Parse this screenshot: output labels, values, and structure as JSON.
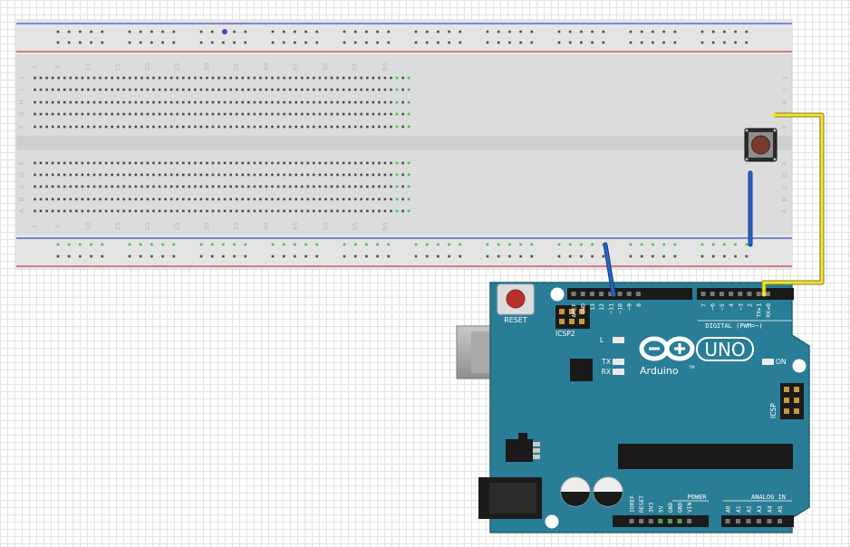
{
  "breadboard": {
    "column_numbers": [
      "1",
      "5",
      "10",
      "15",
      "20",
      "25",
      "30",
      "35",
      "40",
      "45",
      "50",
      "55",
      "60"
    ],
    "row_letters_top": [
      "J",
      "I",
      "H",
      "G",
      "F"
    ],
    "row_letters_bottom": [
      "E",
      "D",
      "C",
      "B",
      "A"
    ]
  },
  "arduino": {
    "reset_label": "RESET",
    "icsp2_label": "ICSP2",
    "icsp_label": "ICSP",
    "led_l_label": "L",
    "led_tx_label": "TX",
    "led_rx_label": "RX",
    "on_label": "ON",
    "brand_label": "Arduino",
    "tm_label": "TM",
    "model_label": "UNO",
    "digital_label": "DIGITAL (PWM=~)",
    "power_label": "POWER",
    "analog_label": "ANALOG IN",
    "digital_pins_left": [
      "AREF",
      "GND",
      "13",
      "12",
      "~11",
      "~10",
      "~9",
      "8"
    ],
    "digital_pins_right": [
      "7",
      "~6",
      "~5",
      "4",
      "~3",
      "2",
      "TX▸1",
      "RX◂0"
    ],
    "power_pins": [
      "IOREF",
      "RESET",
      "3V3",
      "5V",
      "GND",
      "GND",
      "VIN"
    ],
    "analog_pins": [
      "A0",
      "A1",
      "A2",
      "A3",
      "A4",
      "A5"
    ]
  },
  "colors": {
    "board": "#2a7d96",
    "wire_yellow": "#f0e23a",
    "wire_blue": "#2a62c6",
    "rail_red": "#d23a3a",
    "rail_blue": "#3a4fc6",
    "connected_hole": "#3cc83c"
  }
}
